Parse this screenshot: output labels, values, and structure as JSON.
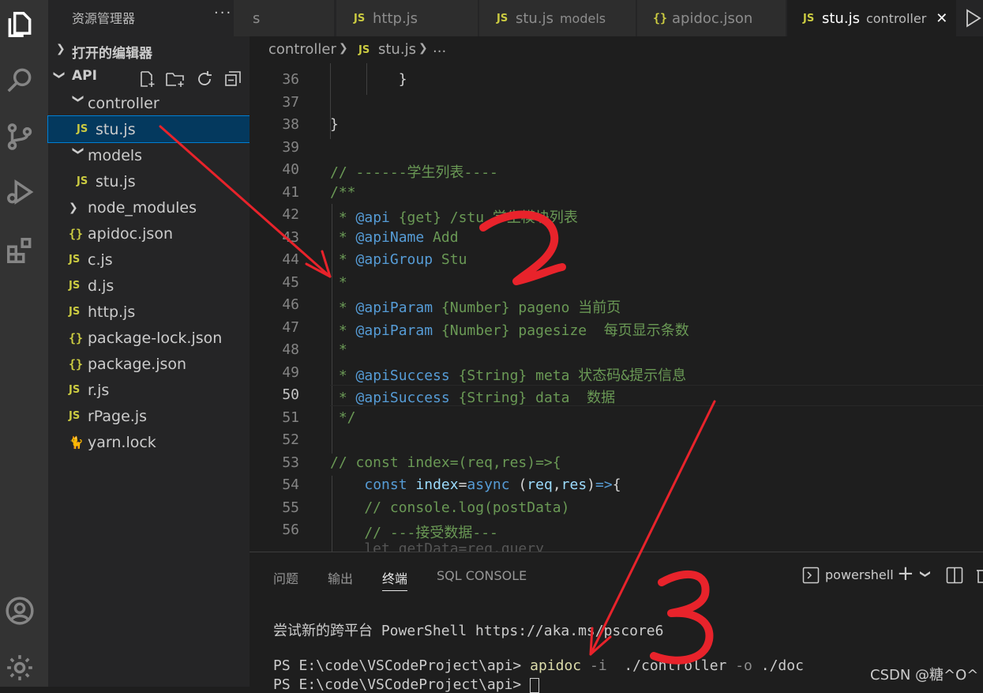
{
  "sidebar": {
    "title": "资源管理器",
    "more": "···",
    "open_editors": "打开的编辑器",
    "project": "API",
    "tree": [
      {
        "label": "controller",
        "type": "folder",
        "depth": 1
      },
      {
        "label": "stu.js",
        "type": "js",
        "depth": 2,
        "selected": true
      },
      {
        "label": "models",
        "type": "folder",
        "depth": 1
      },
      {
        "label": "stu.js",
        "type": "js",
        "depth": 2
      },
      {
        "label": "node_modules",
        "type": "folder-collapsed",
        "depth": 1
      },
      {
        "label": "apidoc.json",
        "type": "json",
        "depth": 1
      },
      {
        "label": "c.js",
        "type": "js",
        "depth": 1
      },
      {
        "label": "d.js",
        "type": "js",
        "depth": 1
      },
      {
        "label": "http.js",
        "type": "js",
        "depth": 1
      },
      {
        "label": "package-lock.json",
        "type": "json",
        "depth": 1
      },
      {
        "label": "package.json",
        "type": "json",
        "depth": 1
      },
      {
        "label": "r.js",
        "type": "js",
        "depth": 1
      },
      {
        "label": "rPage.js",
        "type": "js",
        "depth": 1
      },
      {
        "label": "yarn.lock",
        "type": "yarn",
        "depth": 1
      }
    ]
  },
  "icons": {
    "js": "JS",
    "json": "{}",
    "close": "✕"
  },
  "tabs": [
    {
      "label": "s",
      "desc": "",
      "icon": ""
    },
    {
      "label": "http.js",
      "desc": "",
      "icon": "js"
    },
    {
      "label": "stu.js",
      "desc": "models",
      "icon": "js"
    },
    {
      "label": "apidoc.json",
      "desc": "",
      "icon": "json"
    },
    {
      "label": "stu.js",
      "desc": "controller",
      "icon": "js",
      "active": true
    }
  ],
  "breadcrumb": {
    "folder": "controller",
    "file": "stu.js",
    "more": "..."
  },
  "editor": {
    "current_line": 50,
    "lines": [
      {
        "n": "36",
        "text": "        }"
      },
      {
        "n": "37",
        "text": ""
      },
      {
        "n": "38",
        "text": "}"
      },
      {
        "n": "39",
        "text": ""
      },
      {
        "n": "40",
        "text": "// ------学生列表----"
      },
      {
        "n": "41",
        "text": "/**"
      },
      {
        "n": "42",
        "text": " * @api {get} /stu 学生模块列表"
      },
      {
        "n": "43",
        "text": " * @apiName Add"
      },
      {
        "n": "44",
        "text": " * @apiGroup Stu"
      },
      {
        "n": "45",
        "text": " *"
      },
      {
        "n": "46",
        "text": " * @apiParam {Number} pageno 当前页"
      },
      {
        "n": "47",
        "text": " * @apiParam {Number} pagesize  每页显示条数"
      },
      {
        "n": "48",
        "text": " *"
      },
      {
        "n": "49",
        "text": " * @apiSuccess {String} meta 状态码&提示信息"
      },
      {
        "n": "50",
        "text": " * @apiSuccess {String} data  数据"
      },
      {
        "n": "51",
        "text": " */"
      },
      {
        "n": "52",
        "text": ""
      },
      {
        "n": "53",
        "text": "// const index=(req,res)=>{"
      },
      {
        "n": "54",
        "text": "    const index=async (req,res)=>{"
      },
      {
        "n": "55",
        "text": "    // console.log(postData)"
      },
      {
        "n": "56",
        "text": "    // ---接受数据---"
      }
    ]
  },
  "panel": {
    "tabs": [
      "问题",
      "输出",
      "终端",
      "SQL CONSOLE"
    ],
    "active_tab": "终端",
    "shell": "powershell",
    "add": "+",
    "terminal": {
      "line1": "尝试新的跨平台 PowerShell https://aka.ms/pscore6",
      "prompt": "PS E:\\code\\VSCodeProject\\api> ",
      "cmd": "apidoc",
      "args1": " -i",
      "args2": "  ./controller ",
      "args3": "-o",
      "args4": " ./doc",
      "prompt2": "PS E:\\code\\VSCodeProject\\api> "
    }
  },
  "watermark": "CSDN @糖^O^",
  "annotations": [
    "2",
    "3"
  ],
  "colors": {
    "annotation": "#e8232b",
    "selection": "#04395e",
    "accent": "#007fd4"
  }
}
